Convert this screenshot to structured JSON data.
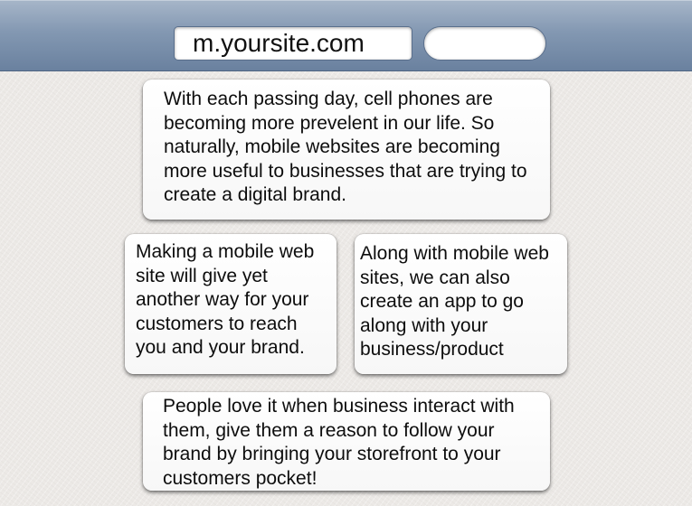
{
  "address_bar": {
    "url": "m.yoursite.com",
    "search_value": ""
  },
  "cards": [
    {
      "text": "With each passing day, cell phones are becoming more prevelent in our life. So naturally, mobile websites are becoming more useful to businesses that are trying to create a digital brand."
    },
    {
      "text": "Making a mobile web site will give yet another way for your customers to reach you and your brand."
    },
    {
      "text": "Along with mobile web sites, we can also create an app to go along with your business/product"
    },
    {
      "text": "People love it when business interact with them, give them a reason to follow your brand by bringing your storefront to your customers pocket!"
    }
  ],
  "colors": {
    "toolbar_top": "#a7b6c9",
    "toolbar_bottom": "#6a819f",
    "page_background": "#ece9e6",
    "card_background": "#ffffff"
  }
}
